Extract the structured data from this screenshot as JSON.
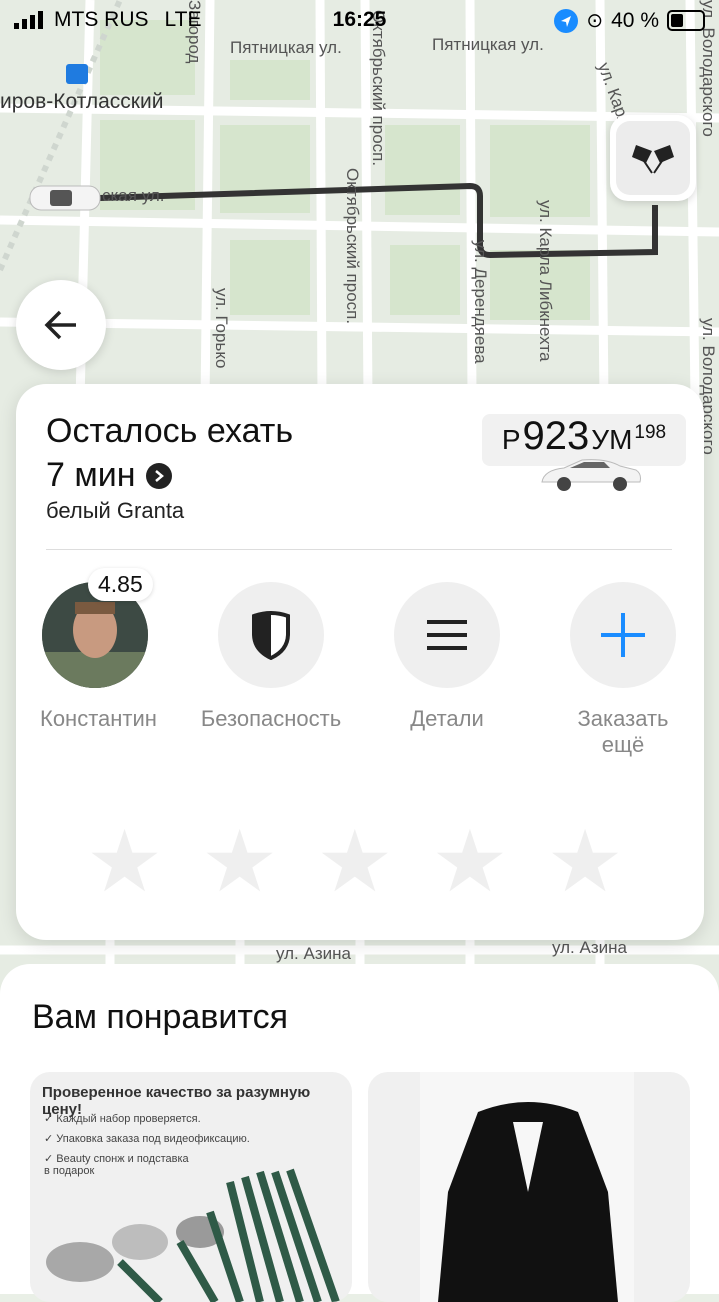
{
  "status_bar": {
    "carrier": "MTS RUS",
    "network": "LTE",
    "time": "16:25",
    "battery": "40 %"
  },
  "map": {
    "streets": [
      "Пятницкая ул.",
      "Пятницкая ул.",
      "ирoв-Котласский",
      "ская ул.",
      "Октябрьский просп.",
      "Октябрьский просп.",
      "ул. Дерендяева",
      "ул. Карла Либкнехта",
      "ул. Горько",
      "ул. Азина",
      "ул. Азина",
      "ул. Володарского",
      "ул. Володарского",
      "Загород",
      "ул. Карла"
    ],
    "route_color": "#333333"
  },
  "ride_card": {
    "title_line1": "Осталось ехать",
    "title_line2": "7 мин",
    "car_description": "белый Granta",
    "plate": {
      "prefix": "Р",
      "number": "923",
      "suffix": "УМ",
      "region": "198"
    },
    "driver": {
      "name": "Константин",
      "rating": "4.85"
    },
    "actions": {
      "security": "Безопасность",
      "details": "Детали",
      "order_more": "Заказать ещё"
    },
    "star_count": 5
  },
  "recommendations": {
    "title": "Вам понравится",
    "product1": {
      "headline": "Проверенное качество за разумную цену!",
      "bullets": [
        "Каждый набор проверяется.",
        "Упаковка заказа под видеофиксацию.",
        "Beauty спонж и подставка в подарок"
      ]
    }
  },
  "colors": {
    "accent": "#1a8cff",
    "card_bg": "#ffffff",
    "map_bg": "#e6ece3"
  },
  "icons": [
    "back-arrow-icon",
    "finish-flags-icon",
    "chevron-right-icon",
    "shield-icon",
    "menu-icon",
    "plus-icon",
    "star-icon",
    "location-arrow-icon",
    "battery-icon",
    "signal-icon"
  ]
}
